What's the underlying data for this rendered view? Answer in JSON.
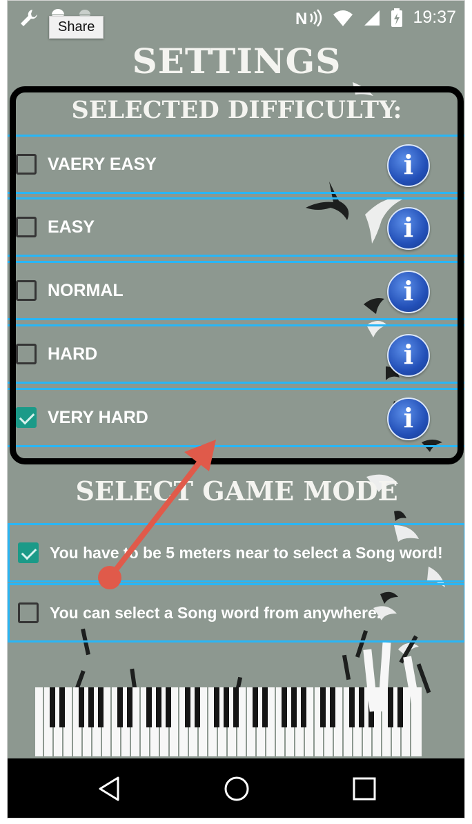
{
  "status_bar": {
    "time": "19:37",
    "share_tooltip": "Share",
    "icons": [
      "wrench-icon",
      "android-icon",
      "nfc-icon",
      "wifi-icon",
      "signal-icon",
      "battery-charging-icon"
    ]
  },
  "page": {
    "title": "SETTINGS"
  },
  "difficulty": {
    "title": "SELECTED DIFFICULTY:",
    "options": [
      {
        "label": "VAERY EASY",
        "checked": false,
        "info_icon": "info-icon"
      },
      {
        "label": "EASY",
        "checked": false,
        "info_icon": "info-icon"
      },
      {
        "label": "NORMAL",
        "checked": false,
        "info_icon": "info-icon"
      },
      {
        "label": "HARD",
        "checked": false,
        "info_icon": "info-icon"
      },
      {
        "label": "VERY HARD",
        "checked": true,
        "info_icon": "info-icon"
      }
    ],
    "info_glyph": "i"
  },
  "game_mode": {
    "title": "SELECT GAME MODE",
    "options": [
      {
        "label": "You have to be 5 meters near to select a Song word!",
        "checked": true
      },
      {
        "label": "You can select a Song word from anywhere.",
        "checked": false
      }
    ]
  },
  "annotation": {
    "arrow_color": "#e05a4a",
    "frame_color": "#000000"
  },
  "colors": {
    "background": "#8d9890",
    "row_border": "#29b6f6",
    "checkbox_checked": "#1b9a88",
    "info_button": "#2350b8"
  },
  "nav_bar": {
    "icons": [
      "back-triangle-icon",
      "home-circle-icon",
      "recents-square-icon"
    ]
  }
}
